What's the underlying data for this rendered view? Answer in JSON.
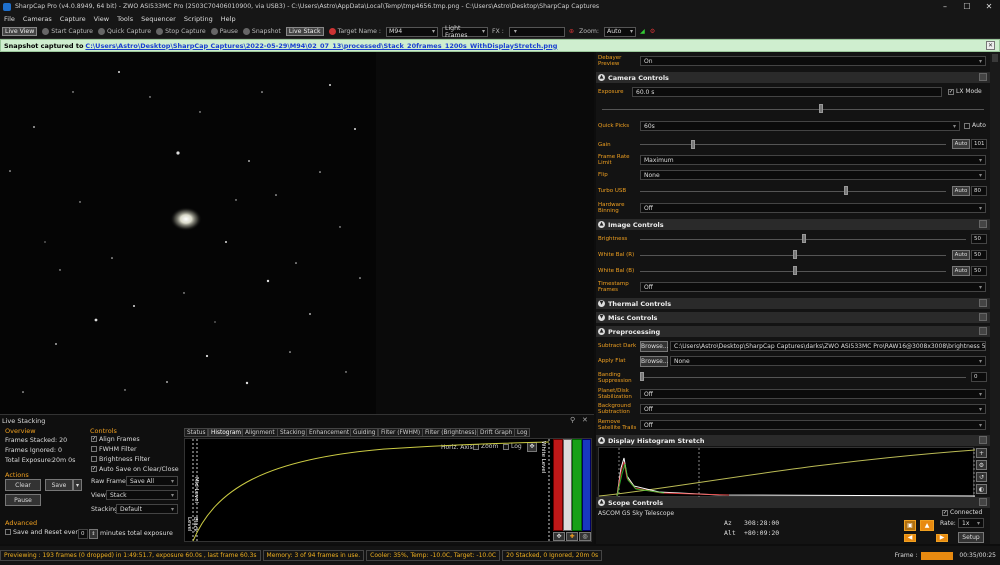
{
  "titlebar": {
    "title": "SharpCap Pro (v4.0.8949, 64 bit) - ZWO ASI533MC Pro (2503C70406010900, via USB3) - C:\\Users\\Astro\\AppData\\Local\\Temp\\tmp4656.tmp.png - C:\\Users\\Astro\\Desktop\\SharpCap Captures"
  },
  "menu": [
    "File",
    "Cameras",
    "Capture",
    "View",
    "Tools",
    "Sequencer",
    "Scripting",
    "Help"
  ],
  "toolbar": {
    "live_view": "Live View",
    "start_capture": "Start Capture",
    "quick_capture": "Quick Capture",
    "stop_capture": "Stop Capture",
    "pause": "Pause",
    "snapshot": "Snapshot",
    "live_stack": "Live Stack",
    "target_label": "Target Name :",
    "target_value": "M94",
    "frames": "Light Frames",
    "fx": "FX :",
    "zoom_label": "Zoom:",
    "zoom_value": "Auto"
  },
  "notification": {
    "text": "Snapshot captured to",
    "link": "C:\\Users\\Astro\\Desktop\\SharpCap Captures\\2022-05-29\\M94\\02_07_13\\processed\\Stack_20frames_1200s_WithDisplayStretch.png"
  },
  "right": {
    "debayer": {
      "label": "Debayer Preview",
      "value": "On"
    },
    "camera_controls": {
      "title": "Camera Controls",
      "exposure_label": "Exposure",
      "exposure_value": "60.0 s",
      "lx_mode": "LX Mode",
      "quick_picks_label": "Quick Picks",
      "quick_picks_value": "60s",
      "auto": "Auto",
      "gain_label": "Gain",
      "gain_value": "101",
      "frame_rate_label": "Frame Rate Limit",
      "frame_rate_value": "Maximum",
      "flip_label": "Flip",
      "flip_value": "None",
      "turbo_label": "Turbo USB",
      "turbo_value": "80",
      "hw_binning_label": "Hardware Binning",
      "hw_binning_value": "Off"
    },
    "image_controls": {
      "title": "Image Controls",
      "brightness_label": "Brightness",
      "brightness_value": "50",
      "wbr_label": "White Bal (R)",
      "wbr_value": "50",
      "wbb_label": "White Bal (B)",
      "wbb_value": "50",
      "timestamp_label": "Timestamp Frames",
      "timestamp_value": "Off"
    },
    "thermal": "Thermal Controls",
    "misc": "Misc Controls",
    "preprocessing": {
      "title": "Preprocessing",
      "dark_label": "Subtract Dark",
      "browse": "Browse...",
      "dark_value": "C:\\Users\\Astro\\Desktop\\SharpCap Captures\\darks\\ZWO ASI533MC Pro\\RAW16@3008x3008\\brightness 50...",
      "flat_label": "Apply Flat",
      "flat_value": "None",
      "banding_label": "Banding Suppression",
      "banding_value": "0",
      "planet_label": "Planet/Disk Stabilization",
      "planet_value": "Off",
      "bg_label": "Background Subtraction",
      "bg_value": "Off",
      "sat_label": "Remove Satellite Trails",
      "sat_value": "Off"
    },
    "histogram": {
      "title": "Display Histogram Stretch"
    },
    "scope": {
      "title": "Scope Controls",
      "name": "ASCOM GS Sky Telescope",
      "connected": "Connected",
      "az_label": "Az",
      "az_value": "308:28:00",
      "alt_label": "Alt",
      "alt_value": "+80:09:20",
      "rate_label": "Rate:",
      "rate_value": "1x",
      "setup": "Setup"
    }
  },
  "stacking": {
    "title": "Live Stacking",
    "overview": "Overview",
    "frames_stacked": "Frames Stacked: 20",
    "frames_ignored": "Frames Ignored: 0",
    "total_exposure": "Total Exposure:",
    "total_exposure_value": "20m 0s",
    "actions": "Actions",
    "clear": "Clear",
    "save": "Save",
    "pause": "Pause",
    "advanced": "Advanced",
    "save_reset": "Save and Reset every",
    "save_reset_value": "0",
    "minutes": "minutes total exposure",
    "controls": "Controls",
    "align": "Align Frames",
    "fwhm": "FWHM Filter",
    "brightness": "Brightness Filter",
    "autosave": "Auto Save on Clear/Close",
    "raw_label": "Raw Frames",
    "raw_value": "Save All",
    "view_label": "View",
    "view_value": "Stack",
    "stacking_label": "Stacking",
    "stacking_value": "Default",
    "tabs": [
      "Status",
      "Histogram",
      "Alignment",
      "Stacking",
      "Enhancement",
      "Guiding",
      "Filter (FWHM)",
      "Filter (Brightness)",
      "Drift Graph",
      "Log"
    ],
    "horiz": "Horiz. Axis:",
    "zoom": "Zoom",
    "log": "Log",
    "mid_level": "Mid Level",
    "black_level": "Black Level",
    "white_level": "White Level"
  },
  "status": {
    "preview": "Previewing : 193 frames (0 dropped) in 1:49:51.7, exposure 60.0s , last frame 60.3s",
    "memory": "Memory: 3 of 94 frames in use.",
    "cooler": "Cooler: 35%, Temp: -10.0C, Target: -10.0C",
    "stack": "20 Stacked, 0 Ignored, 20m 0s",
    "frame": "Frame :",
    "time": "00:35/00:25"
  },
  "colors": {
    "accent": "#f0a020",
    "notify_bg": "#cfeecf"
  }
}
